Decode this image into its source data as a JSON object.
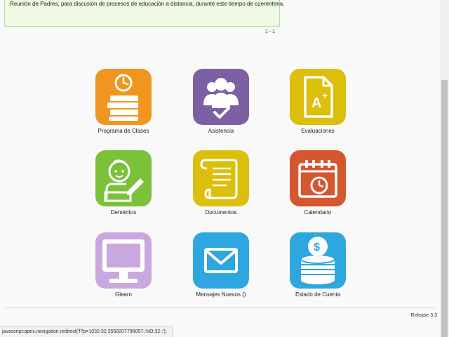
{
  "announcement": {
    "text": "Reunión de Padres, para discusión de procesos de educación a distancia, durante este tiempo de cuerentena."
  },
  "pagination": {
    "label": "1 - 1"
  },
  "tiles": [
    {
      "label": "Programa de Clases",
      "color": "#f0961e",
      "icon": "clock-books-icon"
    },
    {
      "label": "Asistencia",
      "color": "#7d5fa3",
      "icon": "attendance-people-check-icon"
    },
    {
      "label": "Evaluaciones",
      "color": "#dcbf0a",
      "icon": "grade-document-icon"
    },
    {
      "label": "Deméritos",
      "color": "#7cc13a",
      "icon": "student-writing-icon"
    },
    {
      "label": "Documentos",
      "color": "#dcbf0a",
      "icon": "scroll-document-icon"
    },
    {
      "label": "Calendario",
      "color": "#d4572f",
      "icon": "calendar-clock-icon"
    },
    {
      "label": "Glearn",
      "color": "#c9a8e0",
      "icon": "monitor-icon"
    },
    {
      "label": "Mensajes Nuevos ()",
      "color": "#2ea6df",
      "icon": "envelope-icon"
    },
    {
      "label": "Estado de Cuenta",
      "color": "#2ea6df",
      "icon": "coin-stack-icon"
    }
  ],
  "footer": {
    "release": "Release 3.3"
  },
  "statusbar": {
    "text": "javascript:apex.navigation.redirect('f?p=1032:32:3558207796057::NO:32::');"
  }
}
